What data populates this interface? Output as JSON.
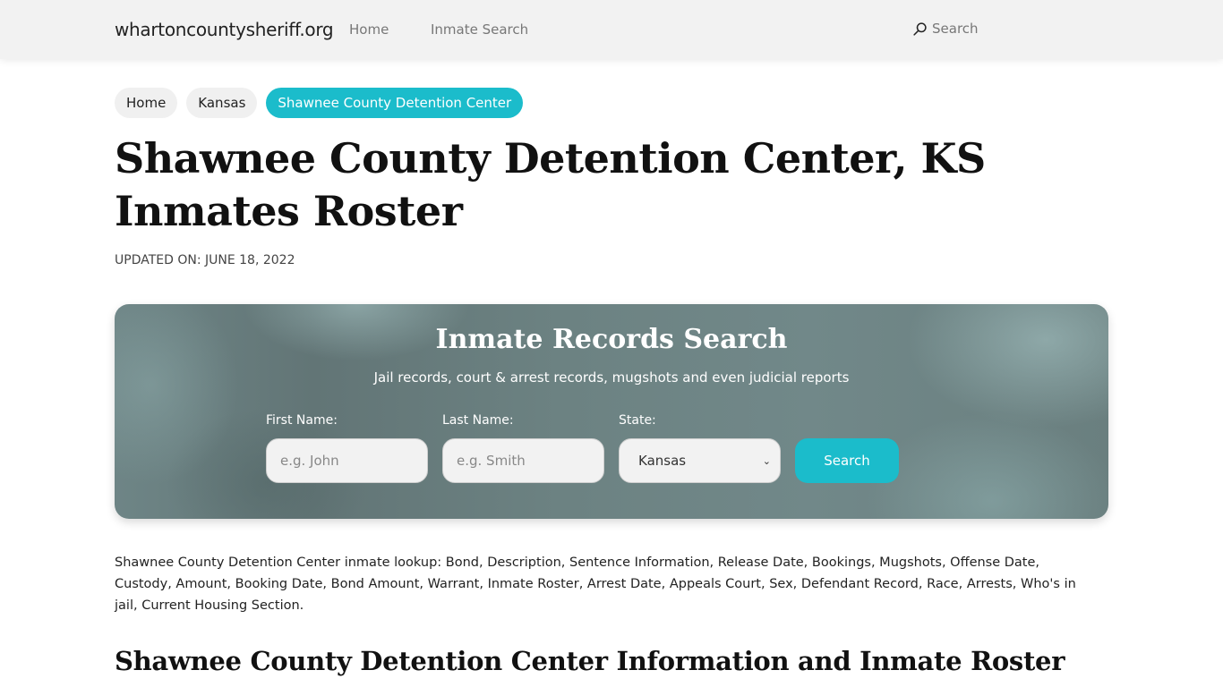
{
  "nav": {
    "brand": "whartoncountysheriff.org",
    "links": [
      {
        "label": "Home"
      },
      {
        "label": "Inmate Search"
      }
    ],
    "search_label": "Search",
    "search_icon": "search-icon"
  },
  "breadcrumb": [
    {
      "label": "Home",
      "active": false
    },
    {
      "label": "Kansas",
      "active": false
    },
    {
      "label": "Shawnee County Detention Center",
      "active": true
    }
  ],
  "page": {
    "title": "Shawnee County Detention Center, KS Inmates Roster",
    "updated": "UPDATED ON: JUNE 18, 2022"
  },
  "search_card": {
    "title": "Inmate Records Search",
    "subtitle": "Jail records, court & arrest records, mugshots and even judicial reports",
    "first_name": {
      "label": "First Name:",
      "placeholder": "e.g. John",
      "value": ""
    },
    "last_name": {
      "label": "Last Name:",
      "placeholder": "e.g. Smith",
      "value": ""
    },
    "state": {
      "label": "State:",
      "selected": "Kansas"
    },
    "button_label": "Search"
  },
  "content": {
    "intro": "Shawnee County Detention Center inmate lookup: Bond, Description, Sentence Information, Release Date, Bookings, Mugshots, Offense Date, Custody, Amount, Booking Date, Bond Amount, Warrant, Inmate Roster, Arrest Date, Appeals Court, Sex, Defendant Record, Race, Arrests, Who's in jail, Current Housing Section.",
    "section_title": "Shawnee County Detention Center Information and Inmate Roster"
  },
  "colors": {
    "accent": "#1bbccb",
    "navbar_bg": "#f2f2f2",
    "crumb_bg": "#f0f0f0"
  }
}
